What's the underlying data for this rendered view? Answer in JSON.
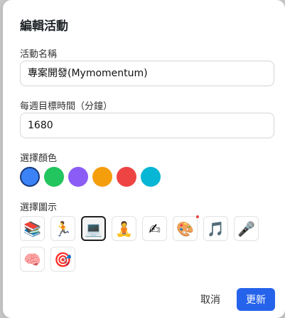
{
  "dialog": {
    "title": "編輯活動",
    "name_label": "活動名稱",
    "name_value": "專案開發(Mymomentum)",
    "target_label": "每週目標時間（分鐘）",
    "target_value": "1680",
    "color_label": "選擇顏色",
    "colors": [
      {
        "name": "blue",
        "hex": "#3b82f6",
        "selected": true
      },
      {
        "name": "green",
        "hex": "#22c55e",
        "selected": false
      },
      {
        "name": "purple",
        "hex": "#8b5cf6",
        "selected": false
      },
      {
        "name": "orange",
        "hex": "#f59e0b",
        "selected": false
      },
      {
        "name": "red",
        "hex": "#ef4444",
        "selected": false
      },
      {
        "name": "cyan",
        "hex": "#06b6d4",
        "selected": false
      }
    ],
    "icon_label": "選擇圖示",
    "icons": [
      {
        "name": "books-icon",
        "glyph": "📚",
        "selected": false
      },
      {
        "name": "runner-icon",
        "glyph": "🏃",
        "selected": false
      },
      {
        "name": "laptop-icon",
        "glyph": "💻",
        "selected": true
      },
      {
        "name": "meditation-icon",
        "glyph": "🧘",
        "selected": false
      },
      {
        "name": "writing-icon",
        "glyph": "✍",
        "selected": false
      },
      {
        "name": "palette-icon",
        "glyph": "🎨",
        "selected": false
      },
      {
        "name": "music-notes-icon",
        "glyph": "🎵",
        "selected": false
      },
      {
        "name": "singer-icon",
        "glyph": "🎤",
        "selected": false
      },
      {
        "name": "brain-icon",
        "glyph": "🧠",
        "selected": false
      },
      {
        "name": "target-icon",
        "glyph": "🎯",
        "selected": false
      }
    ],
    "cancel_label": "取消",
    "save_label": "更新"
  }
}
